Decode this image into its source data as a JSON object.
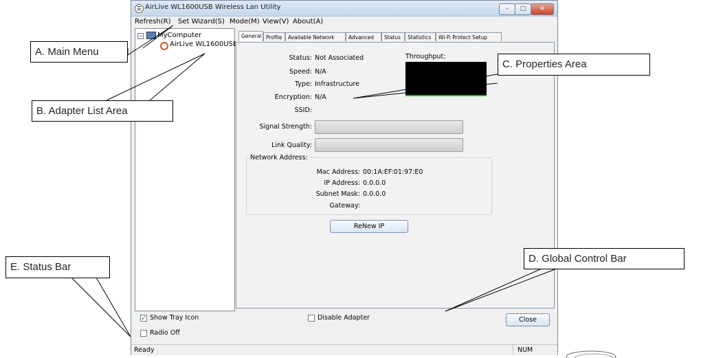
{
  "window": {
    "title": "AirLive WL1600USB Wireless Lan Utility",
    "controls": {
      "minimize": "–",
      "maximize": "□",
      "close": "✕"
    }
  },
  "menu": {
    "items": [
      "Refresh(R)",
      "Set Wizard(S)",
      "Mode(M)",
      "View(V)",
      "About(A)"
    ]
  },
  "adapter_list": {
    "root": "MyComputer",
    "expander": "−",
    "adapter": "AirLive WL1600USB"
  },
  "tabs": [
    "General",
    "Profile",
    "Available Network",
    "Advanced",
    "Status",
    "Statistics",
    "Wi-Fi Protect Setup"
  ],
  "general": {
    "status_label": "Status:",
    "status_value": "Not Associated",
    "speed_label": "Speed:",
    "speed_value": "N/A",
    "type_label": "Type:",
    "type_value": "Infrastructure",
    "encryption_label": "Encryption:",
    "encryption_value": "N/A",
    "ssid_label": "SSID:",
    "ssid_value": "",
    "throughput_label": "Throughput:",
    "signal_label": "Signal Strength:",
    "signal_level": 0,
    "link_label": "Link Quality:",
    "link_level": 0,
    "network_address_label": "Network Address:",
    "mac_label": "Mac Address:",
    "mac_value": "00:1A:EF:01:97:E0",
    "ip_label": "IP Address:",
    "ip_value": "0.0.0.0",
    "subnet_label": "Subnet Mask:",
    "subnet_value": "0.0.0.0",
    "gateway_label": "Gateway:",
    "gateway_value": "",
    "renew_button": "ReNew IP"
  },
  "global_controls": {
    "show_tray_icon": "Show Tray Icon",
    "show_tray_icon_checked": true,
    "radio_off": "Radio Off",
    "radio_off_checked": false,
    "disable_adapter": "Disable Adapter",
    "disable_adapter_checked": false,
    "close_button": "Close"
  },
  "statusbar": {
    "text": "Ready",
    "num": "NUM"
  },
  "callouts": {
    "main_menu": "A. Main Menu",
    "adapter_list": "B. Adapter List Area",
    "properties": "C. Properties Area",
    "global_control": "D. Global Control Bar",
    "status_bar": "E. Status Bar"
  },
  "colors": {
    "graph_bg": "#000000",
    "graph_line": "#00c000",
    "accent": "#2b4f8f"
  }
}
